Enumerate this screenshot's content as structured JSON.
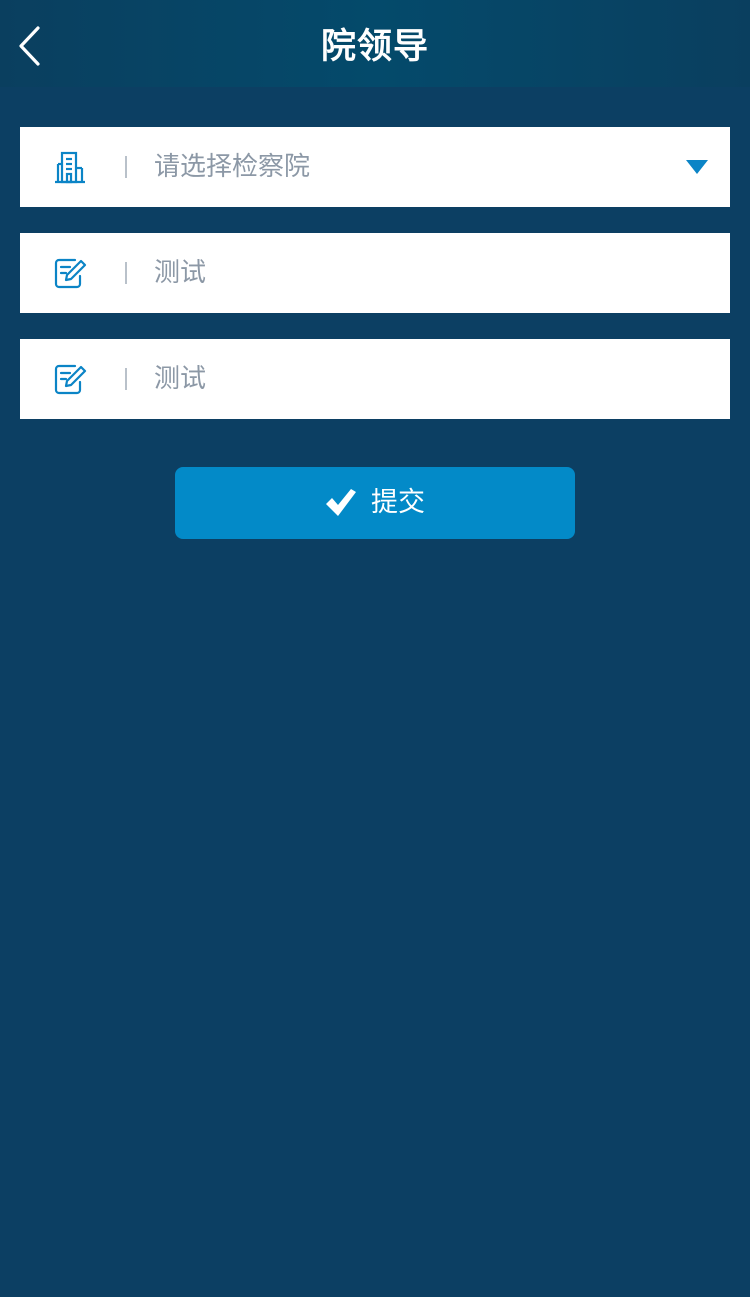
{
  "header": {
    "title": "院领导",
    "back_icon": "chevron-left-icon"
  },
  "form": {
    "procuratorate": {
      "placeholder": "请选择检察院",
      "icon": "building-icon"
    },
    "field_2": {
      "value": "测试",
      "icon": "edit-icon"
    },
    "field_3": {
      "value": "测试",
      "icon": "edit-icon"
    }
  },
  "submit": {
    "label": "提交",
    "icon": "checkmark-icon"
  },
  "colors": {
    "background": "#0c3f63",
    "header": "#0a4466",
    "accent": "#038ac8",
    "icon": "#0b84c6"
  }
}
